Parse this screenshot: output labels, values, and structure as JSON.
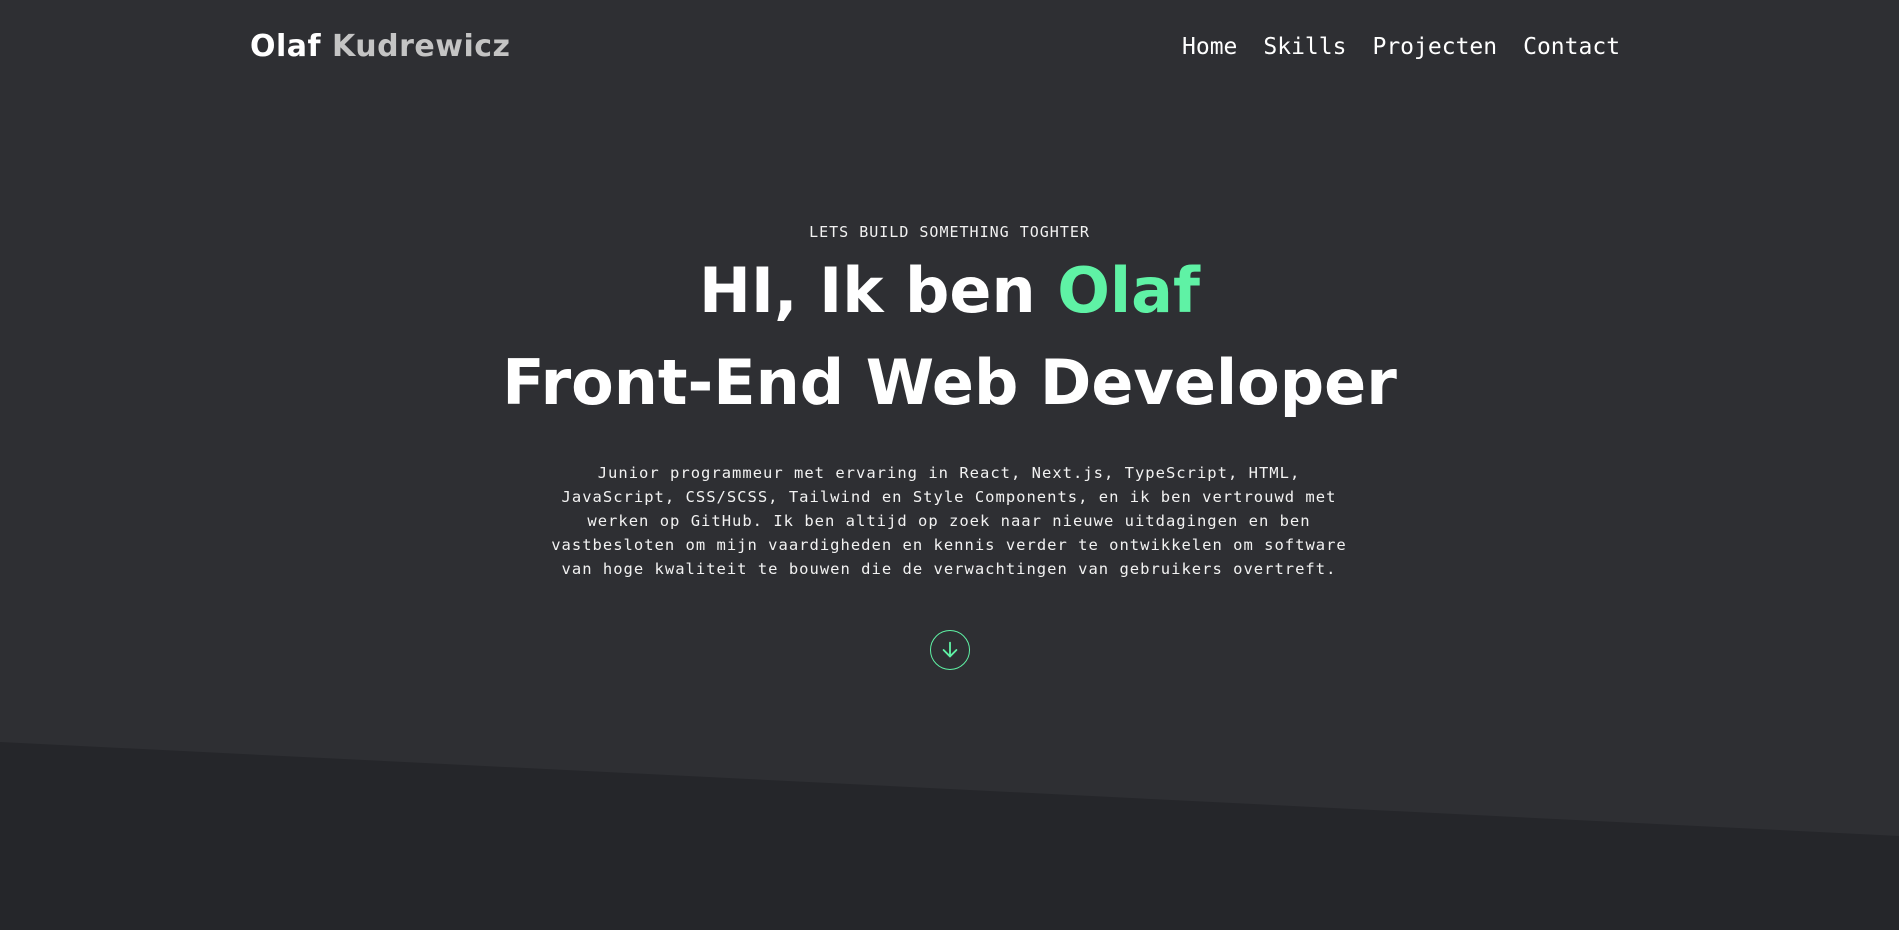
{
  "header": {
    "brand_first": "Olaf",
    "brand_last": "Kudrewicz",
    "nav": [
      {
        "label": "Home"
      },
      {
        "label": "Skills"
      },
      {
        "label": "Projecten"
      },
      {
        "label": "Contact"
      }
    ]
  },
  "hero": {
    "kicker": "LETS BUILD SOMETHING TOGHTER",
    "greeting": "HI, Ik ben",
    "name": "Olaf",
    "role": "Front-End Web Developer",
    "intro": "Junior programmeur met ervaring in React, Next.js, TypeScript, HTML, JavaScript, CSS/SCSS, Tailwind en Style Components, en ik ben vertrouwd met werken op GitHub. Ik ben altijd op zoek naar nieuwe uitdagingen en ben vastbesloten om mijn vaardigheden en kennis verder te ontwikkelen om software van hoge kwaliteit te bouwen die de verwachtingen van gebruikers overtreft.",
    "scroll_icon": "arrow-down-circle-icon"
  },
  "colors": {
    "background": "#2e2f33",
    "band": "#25262a",
    "accent": "#5ff2a5",
    "brand_last": "#c4c4c4"
  }
}
